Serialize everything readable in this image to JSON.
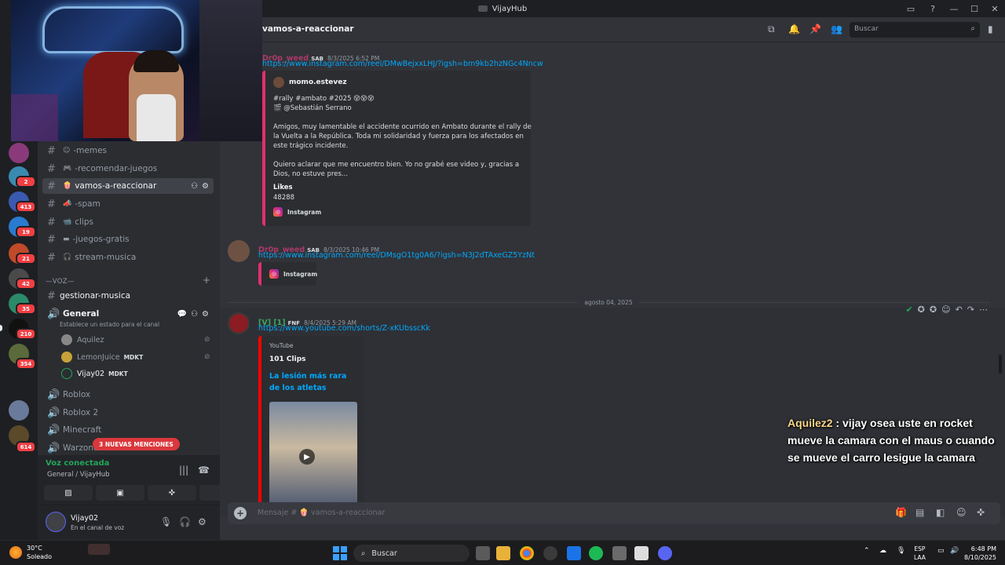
{
  "titlebar": {
    "app_name": "VijayHub"
  },
  "sidebar": {
    "channels": [
      {
        "label": "-memes",
        "emoji": "☺"
      },
      {
        "label": "-recomendar-juegos",
        "emoji": "🎮"
      },
      {
        "label": "vamos-a-reaccionar",
        "emoji": "🍿"
      },
      {
        "label": "-spam",
        "emoji": "📣"
      },
      {
        "label": "clips",
        "emoji": "📹"
      },
      {
        "label": "-juegos-gratis",
        "emoji": "▬"
      },
      {
        "label": "stream-musica",
        "emoji": "🎧"
      }
    ],
    "voice_category": "—VOZ—",
    "gestionar": "gestionar-musica",
    "general": "General",
    "general_status": "Establece un estado para el canal",
    "voice_users": [
      {
        "name": "Aquilez",
        "tag": ""
      },
      {
        "name": "LemonJuice",
        "tag": "MDKT"
      },
      {
        "name": "Vijay02",
        "tag": "MDKT"
      }
    ],
    "voice_channels": [
      "Roblox",
      "Roblox 2",
      "Minecraft",
      "Warzone"
    ],
    "mentions_pill": "3 NUEVAS MENCIONES",
    "voice_panel": {
      "title": "Voz conectada",
      "subtitle": "General / VijayHub"
    },
    "user": {
      "name": "Vijay02",
      "status": "En el canal de voz"
    }
  },
  "rail_badges": [
    "2",
    "413",
    "19",
    "21",
    "42",
    "35",
    "210",
    "354",
    "614"
  ],
  "header": {
    "channel": "vamos-a-reaccionar",
    "search_placeholder": "Buscar"
  },
  "messages": [
    {
      "author": "Dr0p_weed",
      "tag": "SAB",
      "time": "8/3/2025 6:52 PM",
      "link": "https://www.instagram.com/reel/DMwBejxxLHJ/?igsh=bm9kb2hzNGc4Nncw",
      "embed": {
        "author": "momo.estevez",
        "line1": "#rally #ambato #2025 😵😵😵",
        "line2": "🎬 @Sebastián Serrano",
        "body": "Amigos, muy lamentable el accidente ocurrido en Ambato durante el rally de la Vuelta a la República. Toda mi solidaridad y fuerza para los afectados en este trágico incidente.",
        "body2": "Quiero aclarar que me encuentro bien. Yo no grabé ese video y, gracias a Dios, no estuve pres...",
        "field_name": "Likes",
        "field_value": "48288",
        "footer": "Instagram"
      }
    },
    {
      "author": "Dr0p_weed",
      "tag": "SAB",
      "time": "8/3/2025 10:46 PM",
      "link": "https://www.instagram.com/reel/DMsgO1tg0A6/?igsh=N3J2dTAxeGZ5YzNt",
      "embed": {
        "footer": "Instagram"
      }
    },
    {
      "date_divider": "agosto 04, 2025",
      "author": "[V] [1]",
      "tag": "FNF",
      "time": "8/4/2025 5:29 AM",
      "link": "https://www.youtube.com/shorts/Z-xKUbsscKk",
      "embed": {
        "provider": "YouTube",
        "author": "101 Clips",
        "title": "La lesión más rara de los atletas"
      }
    }
  ],
  "composer": {
    "placeholder": "Mensaje # 🍿 vamos-a-reaccionar"
  },
  "overlay_chat": {
    "who": "Aquilez2",
    "text": ": vijay osea uste en rocket mueve la camara con el maus o cuando se mueve el carro lesigue la camara"
  },
  "taskbar": {
    "temp": "30°C",
    "weather": "Soleado",
    "search": "Buscar",
    "lang1": "ESP",
    "lang2": "LAA",
    "time": "6:48 PM",
    "date": "8/10/2025"
  },
  "colors": {
    "accent": "#5865f2",
    "link": "#00a8fc",
    "danger": "#f23f43",
    "online": "#23a55a"
  }
}
